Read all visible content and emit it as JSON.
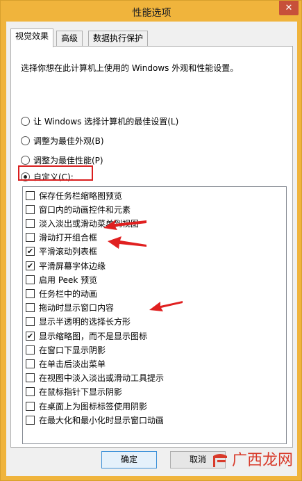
{
  "window": {
    "title": "性能选项",
    "close": "✕"
  },
  "tabs": [
    "视觉效果",
    "高级",
    "数据执行保护"
  ],
  "panel": {
    "description": "选择你想在此计算机上使用的 Windows 外观和性能设置。",
    "radios": [
      {
        "label": "让 Windows 选择计算机的最佳设置(L)",
        "checked": false
      },
      {
        "label": "调整为最佳外观(B)",
        "checked": false
      },
      {
        "label": "调整为最佳性能(P)",
        "checked": false
      },
      {
        "label": "自定义(C):",
        "checked": true
      }
    ],
    "options": [
      {
        "label": "保存任务栏缩略图预览",
        "checked": false
      },
      {
        "label": "窗口内的动画控件和元素",
        "checked": false
      },
      {
        "label": "淡入淡出或滑动菜单到视图",
        "checked": false
      },
      {
        "label": "滑动打开组合框",
        "checked": false
      },
      {
        "label": "平滑滚动列表框",
        "checked": true
      },
      {
        "label": "平滑屏幕字体边缘",
        "checked": true
      },
      {
        "label": "启用 Peek 预览",
        "checked": false
      },
      {
        "label": "任务栏中的动画",
        "checked": false
      },
      {
        "label": "拖动时显示窗口内容",
        "checked": false
      },
      {
        "label": "显示半透明的选择长方形",
        "checked": false
      },
      {
        "label": "显示缩略图，而不是显示图标",
        "checked": true
      },
      {
        "label": "在窗口下显示阴影",
        "checked": false
      },
      {
        "label": "在单击后淡出菜单",
        "checked": false
      },
      {
        "label": "在视图中淡入淡出或滑动工具提示",
        "checked": false
      },
      {
        "label": "在鼠标指针下显示阴影",
        "checked": false
      },
      {
        "label": "在桌面上为图标标签使用阴影",
        "checked": false
      },
      {
        "label": "在最大化和最小化时显示窗口动画",
        "checked": false
      }
    ]
  },
  "buttons": {
    "ok": "确定",
    "cancel": "取消"
  },
  "watermark": {
    "text": "广西龙网"
  },
  "colors": {
    "titlebar": "#f0b43c",
    "highlight": "#d91e1e",
    "arrow": "#e02020"
  }
}
